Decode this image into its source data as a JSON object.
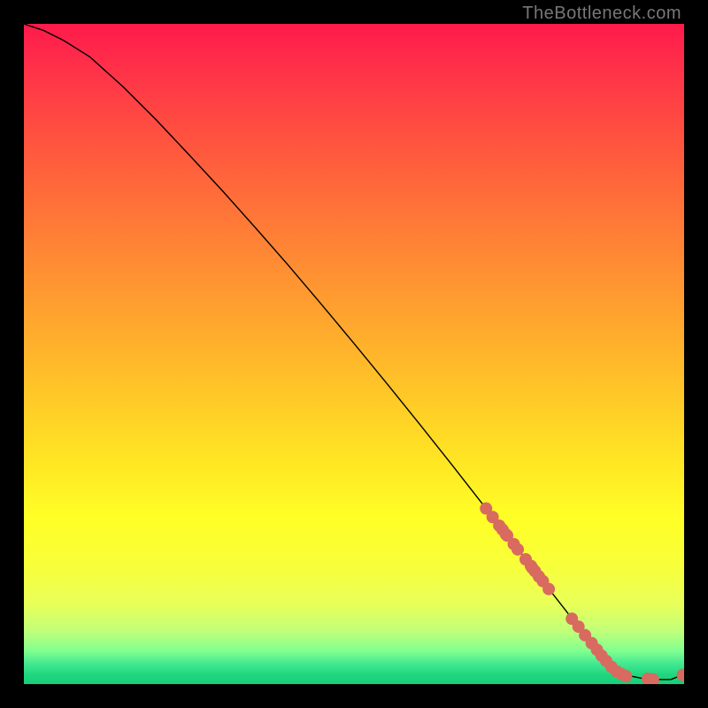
{
  "watermark": "TheBottleneck.com",
  "chart_data": {
    "type": "line",
    "title": "",
    "xlabel": "",
    "ylabel": "",
    "xlim": [
      0,
      100
    ],
    "ylim": [
      0,
      100
    ],
    "series": [
      {
        "name": "curve",
        "x": [
          0,
          3,
          6,
          10,
          15,
          20,
          25,
          30,
          35,
          40,
          45,
          50,
          55,
          60,
          65,
          70,
          75,
          80,
          85,
          88,
          90,
          92,
          94,
          96,
          98,
          100
        ],
        "values": [
          100,
          99,
          97.5,
          95,
          90.5,
          85.5,
          80.2,
          74.8,
          69.2,
          63.5,
          57.6,
          51.6,
          45.5,
          39.3,
          33.0,
          26.6,
          20.2,
          13.8,
          7.4,
          4.0,
          2.2,
          1.2,
          0.8,
          0.7,
          0.7,
          1.5
        ]
      }
    ],
    "scatter_points": {
      "name": "highlighted-dots",
      "x": [
        70.0,
        71.0,
        72.0,
        72.5,
        73.0,
        73.2,
        74.2,
        74.8,
        76.0,
        76.8,
        77.0,
        77.4,
        78.0,
        78.6,
        79.5,
        83.0,
        84.0,
        85.0,
        86.0,
        86.8,
        87.5,
        88.2,
        89.0,
        89.8,
        90.5,
        91.2,
        94.5,
        95.3,
        99.8
      ],
      "values": [
        26.6,
        25.3,
        24.0,
        23.4,
        22.7,
        22.5,
        21.2,
        20.4,
        18.9,
        17.9,
        17.6,
        17.1,
        16.3,
        15.6,
        14.4,
        9.9,
        8.7,
        7.4,
        6.2,
        5.2,
        4.3,
        3.5,
        2.6,
        1.9,
        1.5,
        1.2,
        0.8,
        0.7,
        1.4
      ]
    }
  }
}
